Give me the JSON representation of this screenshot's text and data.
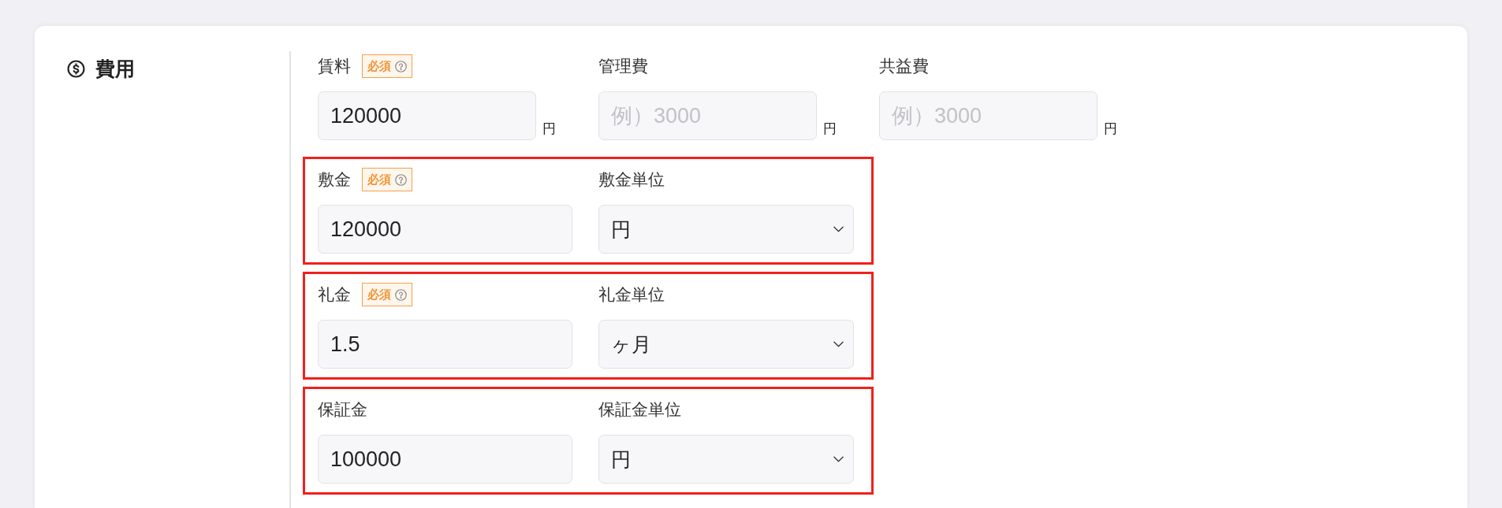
{
  "section": {
    "title": "費用"
  },
  "fees": [
    {
      "label": "賃料",
      "badge": "必須",
      "value": "120000",
      "unit": "円"
    },
    {
      "label": "管理費",
      "placeholder": "例）3000",
      "unit": "円"
    },
    {
      "label": "共益費",
      "placeholder": "例）3000",
      "unit": "円"
    }
  ],
  "deposit_groups": [
    {
      "highlighted": true,
      "amount": {
        "label": "敷金",
        "badge": "必須",
        "value": "120000"
      },
      "unit_select": {
        "label": "敷金単位",
        "value": "円"
      }
    },
    {
      "highlighted": true,
      "amount": {
        "label": "礼金",
        "badge": "必須",
        "value": "1.5"
      },
      "unit_select": {
        "label": "礼金単位",
        "value": "ヶ月"
      }
    },
    {
      "highlighted": true,
      "amount": {
        "label": "保証金",
        "value": "100000"
      },
      "unit_select": {
        "label": "保証金単位",
        "value": "円"
      }
    }
  ]
}
